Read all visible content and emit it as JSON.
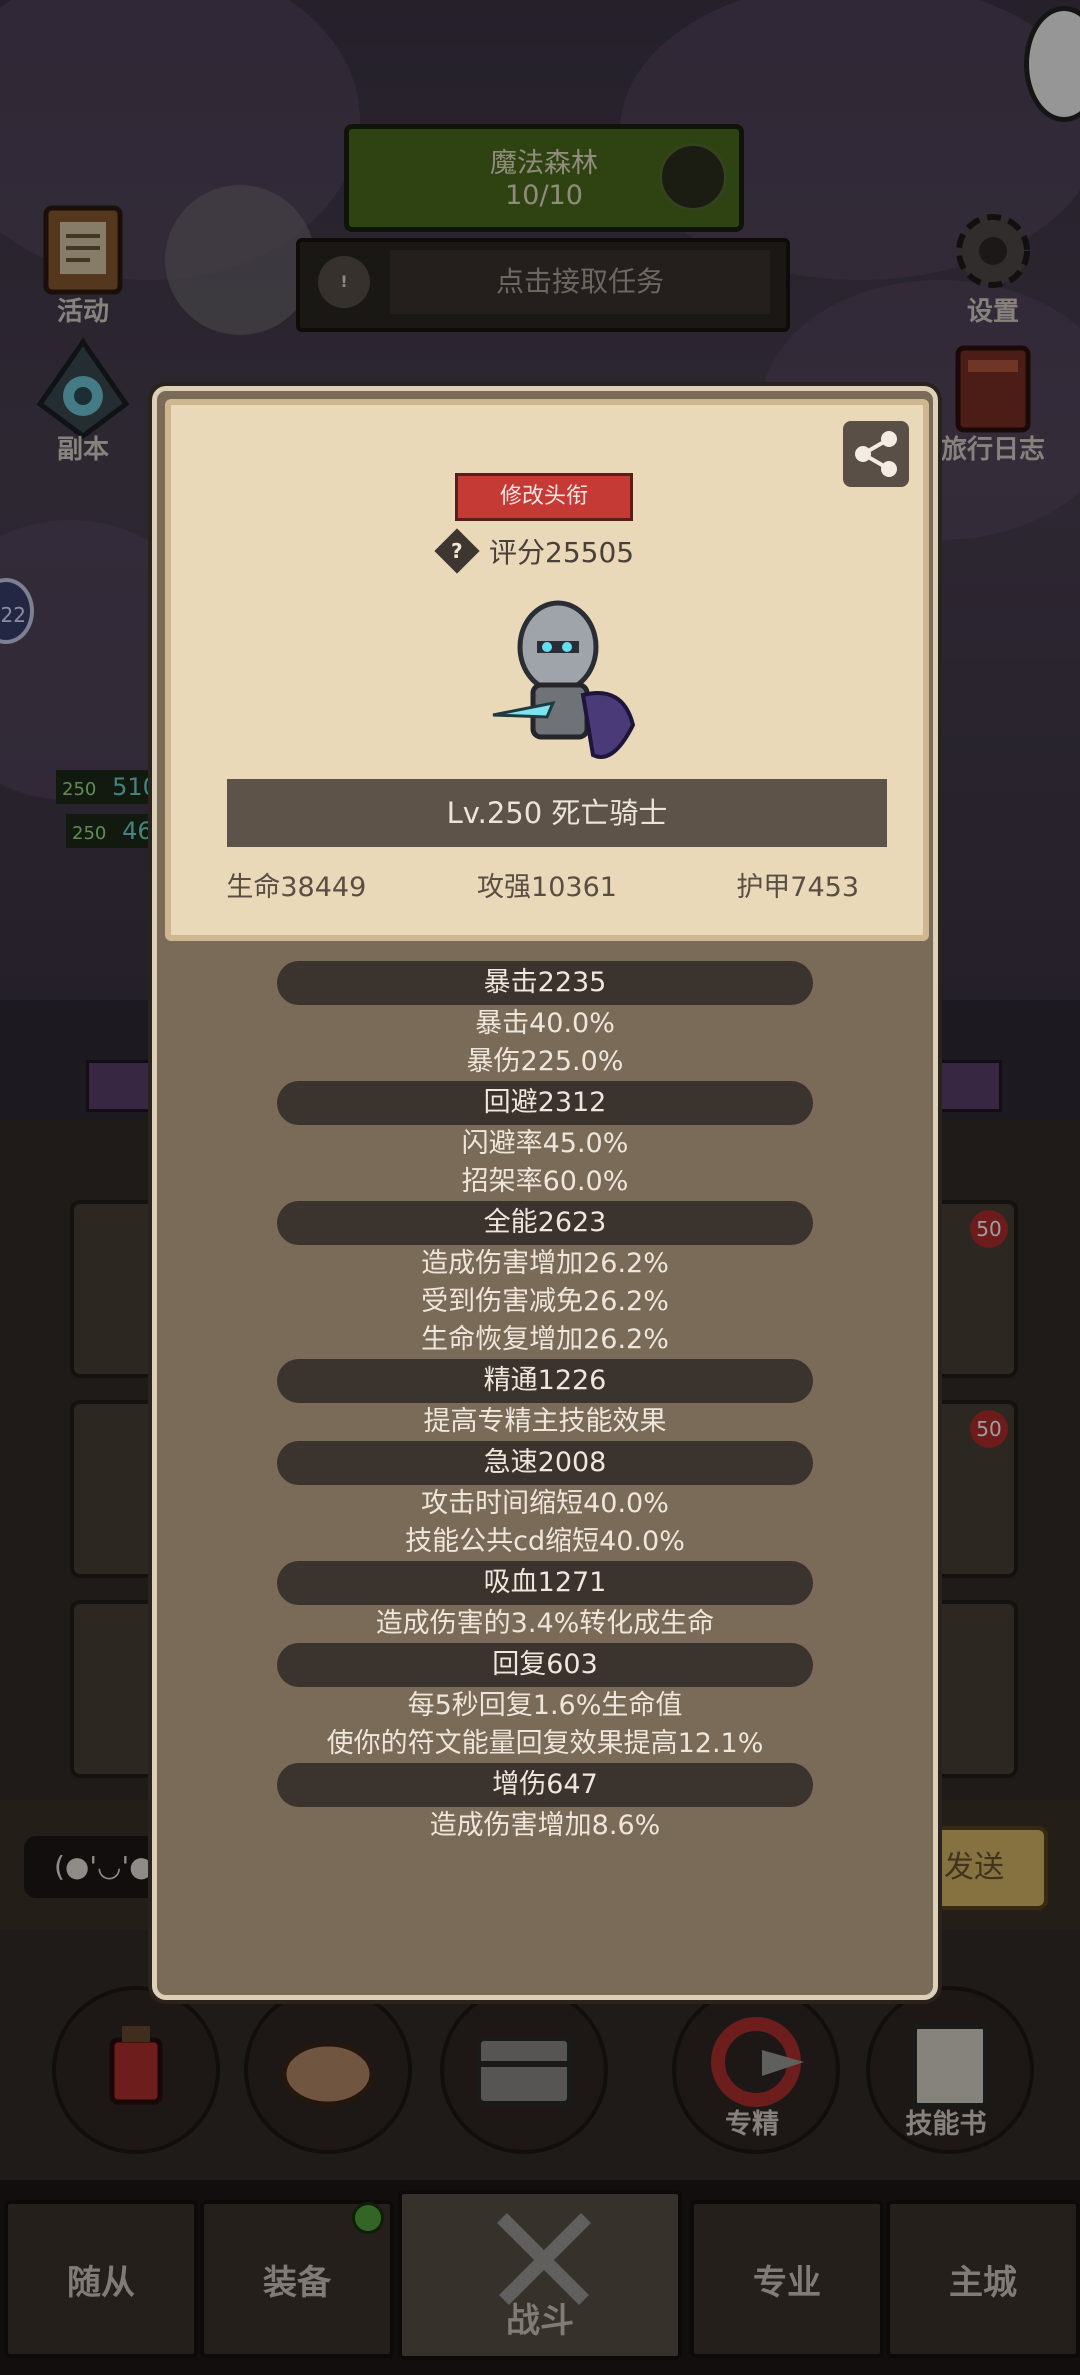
{
  "top": {
    "map_name": "魔法森林",
    "map_progress": "10/10",
    "task_prompt": "点击接取任务",
    "task_icon": "!",
    "left_buttons": [
      {
        "label": "活动",
        "icon": "scroll-icon"
      },
      {
        "label": "副本",
        "icon": "portal-icon"
      }
    ],
    "right_buttons": [
      {
        "label": "设置",
        "icon": "gear-icon"
      },
      {
        "label": "旅行日志",
        "icon": "book-icon"
      }
    ],
    "chat_placeholder": "(●'◡'●",
    "send_label": "发送",
    "chat_prefix": "22"
  },
  "modal": {
    "title_button": "修改头衔",
    "score": "评分25505",
    "help": "?",
    "hero_name": "Lv.250 死亡骑士",
    "stats": [
      "生命38449",
      "攻强10361",
      "护甲7453"
    ],
    "sections": [
      {
        "header": "暴击2235",
        "lines": [
          "暴击40.0%",
          "暴伤225.0%"
        ]
      },
      {
        "header": "回避2312",
        "lines": [
          "闪避率45.0%",
          "招架率60.0%"
        ]
      },
      {
        "header": "全能2623",
        "lines": [
          "造成伤害增加26.2%",
          "受到伤害减免26.2%",
          "生命恢复增加26.2%"
        ]
      },
      {
        "header": "精通1226",
        "lines": [
          "提高专精主技能效果"
        ]
      },
      {
        "header": "急速2008",
        "lines": [
          "攻击时间缩短40.0%",
          "技能公共cd缩短40.0%"
        ]
      },
      {
        "header": "吸血1271",
        "lines": [
          "造成伤害的3.4%转化成生命"
        ]
      },
      {
        "header": "回复603",
        "lines": [
          "每5秒回复1.6%生命值",
          "使你的符文能量回复效果提高12.1%"
        ]
      },
      {
        "header": "增伤647",
        "lines": [
          "造成伤害增加8.6%"
        ]
      }
    ]
  },
  "round_buttons": [
    {
      "label": "",
      "icon": "potion-icon"
    },
    {
      "label": "",
      "icon": "bread-icon"
    },
    {
      "label": "",
      "icon": "chest-icon"
    },
    {
      "label": "专精",
      "icon": "specialization-icon"
    },
    {
      "label": "技能书",
      "icon": "skill-book-icon"
    }
  ],
  "bottom_nav": [
    {
      "label": "随从"
    },
    {
      "label": "装备"
    },
    {
      "label": "战斗"
    },
    {
      "label": "专业"
    },
    {
      "label": "主城"
    }
  ],
  "side_levels": [
    "250",
    "250"
  ],
  "side_values": [
    "510",
    "46"
  ],
  "slot_badges": [
    "50",
    "50"
  ],
  "colors": {
    "title_button": "#c53a35",
    "map_bar": "#4c6b1e",
    "card": "#ead9b9",
    "modal": "#7a6a58"
  }
}
